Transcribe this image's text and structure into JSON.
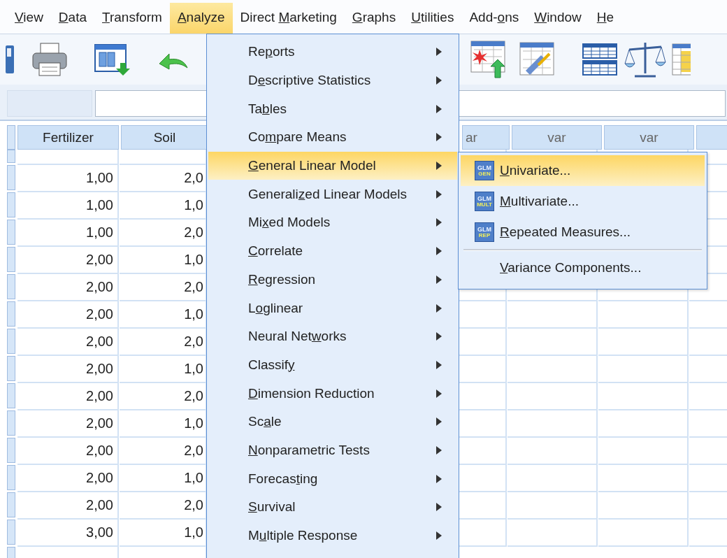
{
  "menubar": [
    {
      "label": {
        "key": "V",
        "after": "iew"
      },
      "selected": false
    },
    {
      "label": {
        "key": "D",
        "after": "ata"
      },
      "selected": false
    },
    {
      "label": {
        "key": "T",
        "after": "ransform"
      },
      "selected": false
    },
    {
      "label": {
        "key": "A",
        "after": "nalyze"
      },
      "selected": true
    },
    {
      "label": {
        "before": "Direct ",
        "key": "M",
        "after": "arketing"
      },
      "selected": false
    },
    {
      "label": {
        "key": "G",
        "after": "raphs"
      },
      "selected": false
    },
    {
      "label": {
        "key": "U",
        "after": "tilities"
      },
      "selected": false
    },
    {
      "label": {
        "before": "Add-",
        "key": "o",
        "after": "ns"
      },
      "selected": false
    },
    {
      "label": {
        "key": "W",
        "after": "indow"
      },
      "selected": false
    },
    {
      "label": {
        "key": "H",
        "after": "e"
      },
      "selected": false
    }
  ],
  "table": {
    "columns": [
      "Fertilizer",
      "Soil",
      "ar",
      "var",
      "var"
    ],
    "rows": [
      [
        "1,00",
        "2,0"
      ],
      [
        "1,00",
        "1,0"
      ],
      [
        "1,00",
        "2,0"
      ],
      [
        "2,00",
        "1,0"
      ],
      [
        "2,00",
        "2,0"
      ],
      [
        "2,00",
        "1,0"
      ],
      [
        "2,00",
        "2,0"
      ],
      [
        "2,00",
        "1,0"
      ],
      [
        "2,00",
        "2,0"
      ],
      [
        "2,00",
        "1,0"
      ],
      [
        "2,00",
        "2,0"
      ],
      [
        "2,00",
        "1,0"
      ],
      [
        "2,00",
        "2,0"
      ],
      [
        "3,00",
        "1,0"
      ]
    ]
  },
  "analyze_menu": {
    "items": [
      {
        "label": {
          "before": "Re",
          "key": "p",
          "after": "orts"
        },
        "selected": false
      },
      {
        "label": {
          "before": "D",
          "key": "e",
          "after": "scriptive Statistics"
        },
        "selected": false
      },
      {
        "label": {
          "before": "Ta",
          "key": "b",
          "after": "les"
        },
        "selected": false
      },
      {
        "label": {
          "before": "Co",
          "key": "m",
          "after": "pare Means"
        },
        "selected": false
      },
      {
        "label": {
          "key": "G",
          "after": "eneral Linear Model"
        },
        "selected": true
      },
      {
        "label": {
          "before": "Generali",
          "key": "z",
          "after": "ed Linear Models"
        },
        "selected": false
      },
      {
        "label": {
          "before": "Mi",
          "key": "x",
          "after": "ed Models"
        },
        "selected": false
      },
      {
        "label": {
          "key": "C",
          "after": "orrelate"
        },
        "selected": false
      },
      {
        "label": {
          "key": "R",
          "after": "egression"
        },
        "selected": false
      },
      {
        "label": {
          "before": "L",
          "key": "o",
          "after": "glinear"
        },
        "selected": false
      },
      {
        "label": {
          "before": "Neural Net",
          "key": "w",
          "after": "orks"
        },
        "selected": false
      },
      {
        "label": {
          "before": "Classif",
          "key": "y"
        },
        "selected": false
      },
      {
        "label": {
          "key": "D",
          "after": "imension Reduction"
        },
        "selected": false
      },
      {
        "label": {
          "before": "Sc",
          "key": "a",
          "after": "le"
        },
        "selected": false
      },
      {
        "label": {
          "key": "N",
          "after": "onparametric Tests"
        },
        "selected": false
      },
      {
        "label": {
          "before": "Forecas",
          "key": "t",
          "after": "ing"
        },
        "selected": false
      },
      {
        "label": {
          "key": "S",
          "after": "urvival"
        },
        "selected": false
      },
      {
        "label": {
          "before": "M",
          "key": "u",
          "after": "ltiple Response"
        },
        "selected": false
      }
    ]
  },
  "glm_submenu": {
    "items": [
      {
        "kind": "command",
        "icon": {
          "top": "GLM",
          "bottom": "GEN"
        },
        "label": {
          "key": "U",
          "after": "nivariate..."
        },
        "selected": true
      },
      {
        "kind": "command",
        "icon": {
          "top": "GLM",
          "bottom": "MULT"
        },
        "label": {
          "key": "M",
          "after": "ultivariate..."
        },
        "selected": false
      },
      {
        "kind": "command",
        "icon": {
          "top": "GLM",
          "bottom": "REP"
        },
        "label": {
          "key": "R",
          "after": "epeated Measures..."
        },
        "selected": false
      },
      {
        "kind": "separator"
      },
      {
        "kind": "command",
        "label": {
          "key": "V",
          "after": "ariance Components..."
        },
        "selected": false
      }
    ]
  }
}
